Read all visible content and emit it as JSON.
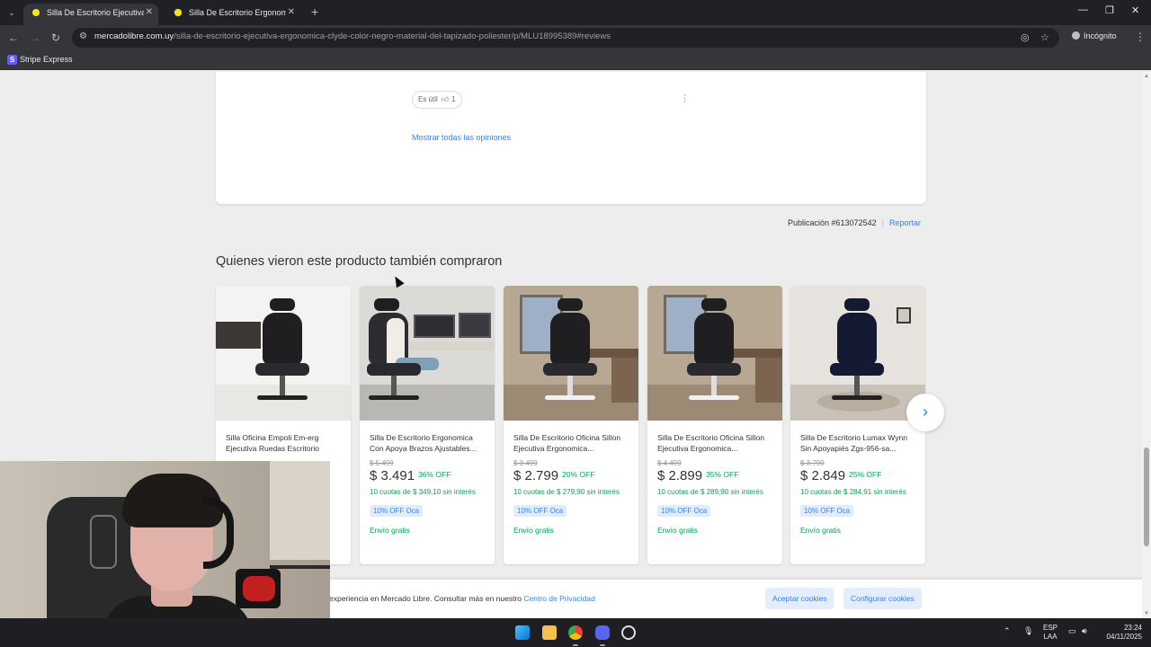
{
  "browser": {
    "tabs": [
      {
        "title": "Silla De Escritorio Ejecutiva Erg",
        "active": true
      },
      {
        "title": "Silla De Escritorio Ergonomica",
        "active": false
      }
    ],
    "url_host": "mercadolibre.com.uy",
    "url_path": "/silla-de-escritorio-ejecutiva-ergonomica-clyde-color-negro-material-del-tapizado-poliester/p/MLU18995389#reviews",
    "mode_label": "Incógnito",
    "bookmarks": [
      {
        "label": "Stripe Express"
      }
    ]
  },
  "review": {
    "useful_label": "Es útil",
    "useful_count": "1",
    "show_all": "Mostrar todas las opiniones"
  },
  "publication": {
    "label": "Publicación #613072542",
    "report": "Reportar"
  },
  "section": {
    "title": "Quienes vieron este producto también compraron"
  },
  "products": [
    {
      "title": "Silla Oficina Empoli Em-erg Ejecutiva Ruedas Escritorio",
      "old_price": "",
      "price": "",
      "discount": "",
      "installments": "",
      "badge": "",
      "shipping": ""
    },
    {
      "title": "Silla De Escritorio Ergonomica Con Apoya Brazos Ajustables...",
      "old_price": "$ 5.499",
      "price": "$ 3.491",
      "discount": "36% OFF",
      "installments": "10 cuotas de $ 349,10 sin interés",
      "badge": "10% OFF Oca",
      "shipping": "Envío gratis"
    },
    {
      "title": "Silla De Escritorio Oficina Sillon Ejecutiva Ergonomica...",
      "old_price": "$ 3.499",
      "price": "$ 2.799",
      "discount": "20% OFF",
      "installments": "10 cuotas de $ 279,90 sin interés",
      "badge": "10% OFF Oca",
      "shipping": "Envío gratis"
    },
    {
      "title": "Silla De Escritorio Oficina Sillon Ejecutiva Ergonomica...",
      "old_price": "$ 4.499",
      "price": "$ 2.899",
      "discount": "35% OFF",
      "installments": "10 cuotas de $ 289,90 sin interés",
      "badge": "10% OFF Oca",
      "shipping": "Envío gratis"
    },
    {
      "title": "Silla De Escritorio Lumax Wynn Sin Apoyapiés Zgs-956-sa...",
      "old_price": "$ 3.799",
      "price": "$ 2.849",
      "discount": "25% OFF",
      "installments": "10 cuotas de $ 284,91 sin interés",
      "badge": "10% OFF Oca",
      "shipping": "Envío gratis"
    }
  ],
  "cookies": {
    "text": "experiencia en Mercado Libre. Consultar más en nuestro",
    "link": "Centro de Privacidad",
    "accept": "Aceptar cookies",
    "configure": "Configurar cookies"
  },
  "taskbar": {
    "lang_top": "ESP",
    "lang_bottom": "LAA",
    "time": "23:24",
    "date": "04/11/2025"
  },
  "colors": {
    "accent_blue": "#3483fa",
    "discount_green": "#00a650",
    "page_bg": "#ededed"
  }
}
